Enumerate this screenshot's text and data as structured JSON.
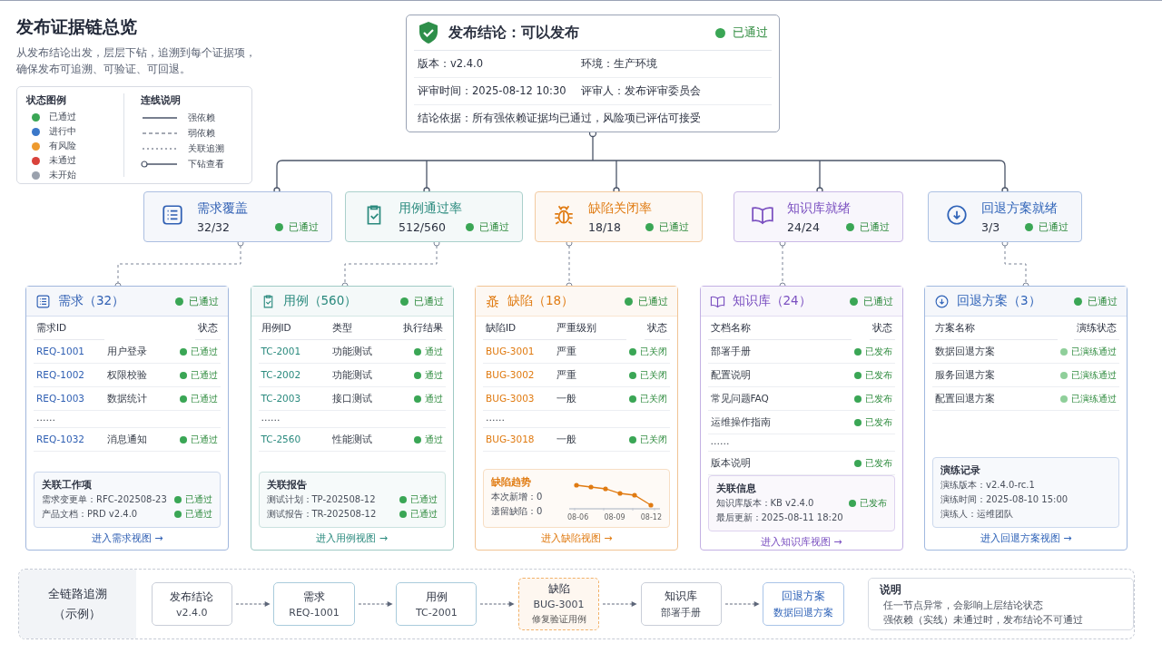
{
  "header": {
    "title": "发布证据链总览",
    "subtitle_lines": [
      "从发布结论出发，层层下钻，追溯到每个证据项，",
      "确保发布可追溯、可验证、可回退。"
    ]
  },
  "legend": {
    "status_title": "状态图例",
    "statuses": [
      {
        "label": "已通过",
        "color": "#3aa655"
      },
      {
        "label": "进行中",
        "color": "#3b78c9"
      },
      {
        "label": "有风险",
        "color": "#ee9a2e"
      },
      {
        "label": "未通过",
        "color": "#d9423b"
      },
      {
        "label": "未开始",
        "color": "#9aa1ad"
      }
    ],
    "line_title": "连线说明",
    "lines": [
      {
        "label": "强依赖",
        "kind": "solid"
      },
      {
        "label": "弱依赖",
        "kind": "dashed"
      },
      {
        "label": "关联追溯",
        "kind": "dotted"
      },
      {
        "label": "下钻查看",
        "kind": "drill"
      }
    ]
  },
  "conclusion": {
    "title": "发布结论：可以发布",
    "status": {
      "label": "已通过",
      "color": "#3aa655"
    },
    "rows": [
      [
        "版本：v2.4.0",
        "环境：生产环境"
      ],
      [
        "评审时间：2025-08-12 10:30",
        "评审人：发布评审委员会"
      ],
      [
        "结论依据：所有强依赖证据均已通过，风险项已评估可接受"
      ]
    ]
  },
  "metrics": [
    {
      "kind": "list",
      "title": "需求覆盖",
      "value": "32/32",
      "color": "#2f5fb3",
      "status": {
        "label": "已通过",
        "color": "#3aa655"
      }
    },
    {
      "kind": "check",
      "title": "用例通过率",
      "value": "512/560",
      "color": "#2a8a7e",
      "status": {
        "label": "已通过",
        "color": "#3aa655"
      }
    },
    {
      "kind": "bug",
      "title": "缺陷关闭率",
      "value": "18/18",
      "color": "#e07b12",
      "status": {
        "label": "已通过",
        "color": "#3aa655"
      }
    },
    {
      "kind": "book",
      "title": "知识库就绪",
      "value": "24/24",
      "color": "#7a4fc0",
      "status": {
        "label": "已通过",
        "color": "#3aa655"
      }
    },
    {
      "kind": "download",
      "title": "回退方案就绪",
      "value": "3/3",
      "color": "#2f63b8",
      "status": {
        "label": "已通过",
        "color": "#3aa655"
      }
    }
  ],
  "details": [
    {
      "kind": "list",
      "title": "需求（32）",
      "color": "#2f5fb3",
      "status": {
        "label": "已通过",
        "color": "#3aa655"
      },
      "columns": [
        "需求ID",
        "状态"
      ],
      "rows": [
        {
          "kind": "item",
          "id": "REQ-1001",
          "name": "用户登录",
          "status": {
            "label": "已通过",
            "color": "#3aa655"
          }
        },
        {
          "kind": "item",
          "id": "REQ-1002",
          "name": "权限校验",
          "status": {
            "label": "已通过",
            "color": "#3aa655"
          }
        },
        {
          "kind": "item",
          "id": "REQ-1003",
          "name": "数据统计",
          "status": {
            "label": "已通过",
            "color": "#3aa655"
          }
        },
        {
          "kind": "ellipsis",
          "text": "……"
        },
        {
          "kind": "item",
          "id": "REQ-1032",
          "name": "消息通知",
          "status": {
            "label": "已通过",
            "color": "#3aa655"
          }
        }
      ],
      "footer": {
        "kind": "list",
        "title": "关联工作项",
        "rows": [
          {
            "text": "需求变更单：RFC-202508-23",
            "status": {
              "label": "已通过",
              "color": "#3aa655"
            }
          },
          {
            "text": "产品文档：PRD v2.4.0",
            "status": {
              "label": "已通过",
              "color": "#3aa655"
            }
          }
        ]
      },
      "link": "进入需求视图 →"
    },
    {
      "kind": "check",
      "title": "用例（560）",
      "color": "#2a8a7e",
      "status": {
        "label": "已通过",
        "color": "#3aa655"
      },
      "columns": [
        "用例ID",
        "类型",
        "执行结果"
      ],
      "rows": [
        {
          "kind": "item",
          "id": "TC-2001",
          "name": "功能测试",
          "status": {
            "label": "通过",
            "color": "#3aa655"
          }
        },
        {
          "kind": "item",
          "id": "TC-2002",
          "name": "功能测试",
          "status": {
            "label": "通过",
            "color": "#3aa655"
          }
        },
        {
          "kind": "item",
          "id": "TC-2003",
          "name": "接口测试",
          "status": {
            "label": "通过",
            "color": "#3aa655"
          }
        },
        {
          "kind": "ellipsis",
          "text": "……"
        },
        {
          "kind": "item",
          "id": "TC-2560",
          "name": "性能测试",
          "status": {
            "label": "通过",
            "color": "#3aa655"
          }
        }
      ],
      "footer": {
        "kind": "list",
        "title": "关联报告",
        "rows": [
          {
            "text": "测试计划：TP-202508-12",
            "status": {
              "label": "已通过",
              "color": "#3aa655"
            }
          },
          {
            "text": "测试报告：TR-202508-12",
            "status": {
              "label": "已通过",
              "color": "#3aa655"
            }
          }
        ]
      },
      "link": "进入用例视图 →"
    },
    {
      "kind": "bug",
      "title": "缺陷（18）",
      "color": "#e07b12",
      "status": {
        "label": "已通过",
        "color": "#3aa655"
      },
      "columns": [
        "缺陷ID",
        "严重级别",
        "状态"
      ],
      "rows": [
        {
          "kind": "item",
          "id": "BUG-3001",
          "name": "严重",
          "status": {
            "label": "已关闭",
            "color": "#3aa655"
          }
        },
        {
          "kind": "item",
          "id": "BUG-3002",
          "name": "严重",
          "status": {
            "label": "已关闭",
            "color": "#3aa655"
          }
        },
        {
          "kind": "item",
          "id": "BUG-3003",
          "name": "一般",
          "status": {
            "label": "已关闭",
            "color": "#3aa655"
          }
        },
        {
          "kind": "ellipsis",
          "text": "……"
        },
        {
          "kind": "item",
          "id": "BUG-3018",
          "name": "一般",
          "status": {
            "label": "已关闭",
            "color": "#3aa655"
          }
        }
      ],
      "footer": {
        "kind": "trend",
        "title": "缺陷趋势",
        "rows": [
          {
            "text": "本次新增：0"
          },
          {
            "text": "遗留缺陷：0"
          }
        ],
        "axis_labels": [
          "08-06",
          "08-09",
          "08-12"
        ]
      },
      "link": "进入缺陷视图 →"
    },
    {
      "kind": "book",
      "title": "知识库（24）",
      "color": "#7a4fc0",
      "status": {
        "label": "已通过",
        "color": "#3aa655"
      },
      "columns": [
        "文档名称",
        "状态"
      ],
      "rows": [
        {
          "kind": "item",
          "name": "部署手册",
          "status": {
            "label": "已发布",
            "color": "#3aa655"
          }
        },
        {
          "kind": "item",
          "name": "配置说明",
          "status": {
            "label": "已发布",
            "color": "#3aa655"
          }
        },
        {
          "kind": "item",
          "name": "常见问题FAQ",
          "status": {
            "label": "已发布",
            "color": "#3aa655"
          }
        },
        {
          "kind": "item",
          "name": "运维操作指南",
          "status": {
            "label": "已发布",
            "color": "#3aa655"
          }
        },
        {
          "kind": "ellipsis",
          "text": "……"
        },
        {
          "kind": "item",
          "name": "版本说明",
          "status": {
            "label": "已发布",
            "color": "#3aa655"
          }
        }
      ],
      "footer": {
        "kind": "list",
        "title": "关联信息",
        "rows": [
          {
            "text": "知识库版本：KB v2.4.0",
            "status": {
              "label": "已发布",
              "color": "#3aa655"
            }
          },
          {
            "text": "最后更新：2025-08-11 18:20"
          }
        ]
      },
      "link": "进入知识库视图 →"
    },
    {
      "kind": "download",
      "title": "回退方案（3）",
      "color": "#2f63b8",
      "status": {
        "label": "已通过",
        "color": "#3aa655"
      },
      "columns": [
        "方案名称",
        "演练状态"
      ],
      "rows": [
        {
          "kind": "item",
          "name": "数据回退方案",
          "status": {
            "label": "已演练通过",
            "color": "#8fcf9a"
          }
        },
        {
          "kind": "item",
          "name": "服务回退方案",
          "status": {
            "label": "已演练通过",
            "color": "#8fcf9a"
          }
        },
        {
          "kind": "item",
          "name": "配置回退方案",
          "status": {
            "label": "已演练通过",
            "color": "#8fcf9a"
          }
        }
      ],
      "footer": {
        "kind": "list",
        "title": "演练记录",
        "rows": [
          {
            "text": "演练版本：v2.4.0-rc.1"
          },
          {
            "text": "演练时间：2025-08-10 15:00"
          },
          {
            "text": "演练人：运维团队"
          }
        ]
      },
      "link": "进入回退方案视图 →"
    }
  ],
  "trace": {
    "title": "全链路追溯",
    "subtitle": "（示例）",
    "nodes": [
      {
        "title": "发布结论",
        "sub": "v2.4.0",
        "color": "#c9ced8",
        "emphasized": false
      },
      {
        "title": "需求",
        "sub": "REQ-1001",
        "color": "#a9cbdc",
        "emphasized": false
      },
      {
        "title": "用例",
        "sub": "TC-2001",
        "color": "#a9cbdc",
        "emphasized": false
      },
      {
        "title": "缺陷",
        "sub": "BUG-3001",
        "note": "修复验证用例",
        "color": "#f2b26a",
        "emphasized": false
      },
      {
        "title": "知识库",
        "sub": "部署手册",
        "color": "#c9ced8",
        "emphasized": false
      },
      {
        "title": "回退方案",
        "sub": "数据回退方案",
        "color": "#a9c4e8",
        "emphasized": true
      }
    ],
    "note": {
      "title": "说明",
      "lines": [
        "任一节点异常，会影响上层结论状态",
        "强依赖（实线）未通过时，发布结论不可通过"
      ]
    }
  }
}
